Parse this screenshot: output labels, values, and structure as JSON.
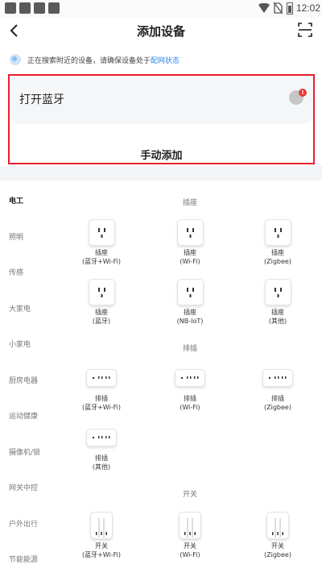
{
  "status_bar": {
    "time": "12:02"
  },
  "header": {
    "title": "添加设备"
  },
  "search_status": {
    "text": "正在搜索附近的设备，请确保设备处于",
    "link": "配网状态"
  },
  "bluetooth_row": {
    "label": "打开蓝牙",
    "badge": "!"
  },
  "manual_add": {
    "label": "手动添加"
  },
  "categories": [
    "电工",
    "照明",
    "传感",
    "大家电",
    "小家电",
    "厨房电器",
    "运动健康",
    "摄像机/锁",
    "网关中控",
    "户外出行",
    "节能能源"
  ],
  "active_category": "电工",
  "sections": {
    "socket": {
      "title": "插座",
      "items": [
        {
          "name": "插座",
          "sub": "(蓝牙+Wi-Fi)"
        },
        {
          "name": "插座",
          "sub": "(Wi-Fi)"
        },
        {
          "name": "插座",
          "sub": "(Zigbee)"
        },
        {
          "name": "插座",
          "sub": "(蓝牙)"
        },
        {
          "name": "插座",
          "sub": "(NB-IoT)"
        },
        {
          "name": "插座",
          "sub": "(其他)"
        }
      ]
    },
    "strip": {
      "title": "排插",
      "items": [
        {
          "name": "排插",
          "sub": "(蓝牙+Wi-Fi)"
        },
        {
          "name": "排插",
          "sub": "(Wi-Fi)"
        },
        {
          "name": "排插",
          "sub": "(Zigbee)"
        },
        {
          "name": "排插",
          "sub": "(其他)"
        }
      ]
    },
    "switch": {
      "title": "开关",
      "items": [
        {
          "name": "开关",
          "sub": "(蓝牙+Wi-Fi)"
        },
        {
          "name": "开关",
          "sub": "(Wi-Fi)"
        },
        {
          "name": "开关",
          "sub": "(Zigbee)"
        }
      ]
    }
  },
  "icons": {
    "back": "chevron-left-icon",
    "scan": "scan-icon",
    "searching": "spinner-icon",
    "bluetooth": "bluetooth-icon"
  },
  "colors": {
    "link": "#2d87e8",
    "highlight_border": "#e8202e",
    "badge": "#e83a3a"
  }
}
